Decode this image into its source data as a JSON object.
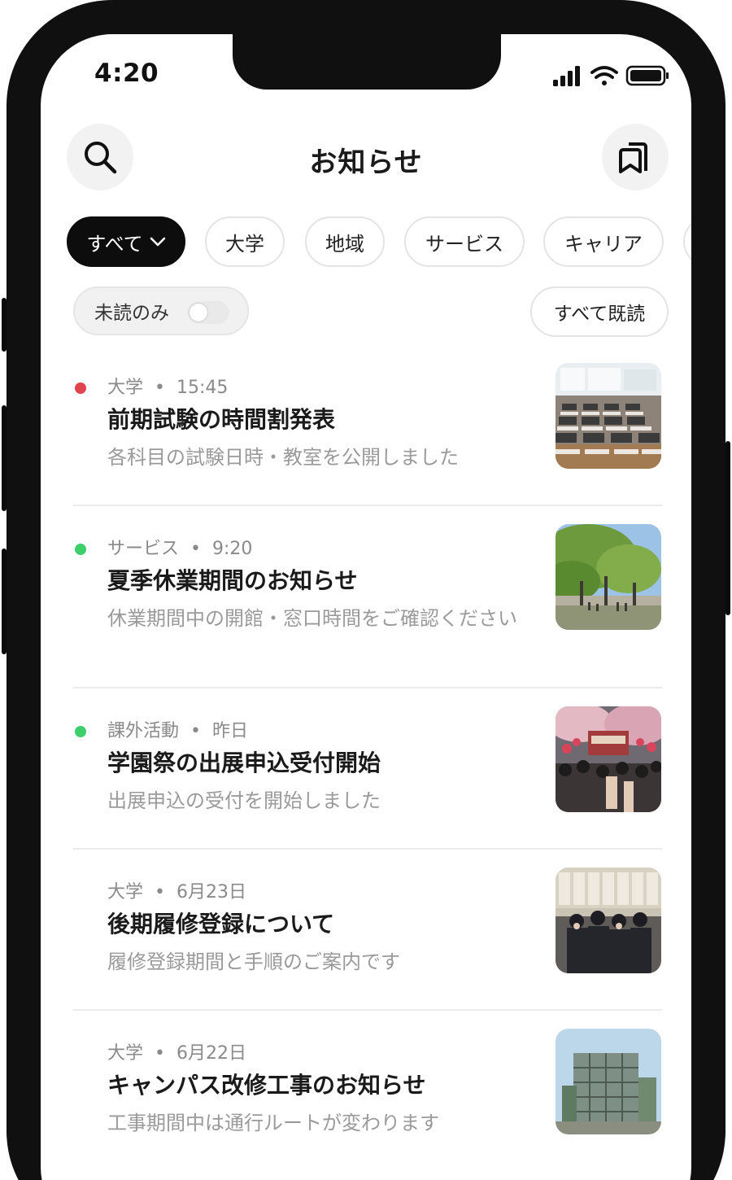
{
  "status_bar": {
    "time": "4:20"
  },
  "header": {
    "title": "お知らせ",
    "search_icon": "search-icon",
    "bookmark_icon": "bookmarks-icon"
  },
  "categories": {
    "items": [
      "すべて",
      "大学",
      "地域",
      "サービス",
      "キャリア"
    ],
    "selected": "すべて"
  },
  "filters": {
    "unread_only_label": "未読のみ",
    "unread_only_enabled": false,
    "mark_all_read_label": "すべて既読"
  },
  "news": [
    {
      "category": "大学",
      "time": "15:45",
      "title": "前期試験の時間割発表",
      "description": "各科目の試験日時・教室を公開しました",
      "dot_color": "#e0444e",
      "thumbnail": "exam-hall-photo"
    },
    {
      "category": "サービス",
      "time": "9:20",
      "title": "夏季休業期間のお知らせ",
      "description": "休業期間中の開館・窓口時間をご確認ください",
      "dot_color": "#3ecf6b",
      "thumbnail": "campus-trees-photo"
    },
    {
      "category": "課外活動",
      "time": "昨日",
      "title": "学園祭の出展申込受付開始",
      "description": "出展申込の受付を開始しました",
      "dot_color": "#3ecf6b",
      "thumbnail": "festival-crowd-photo"
    },
    {
      "category": "大学",
      "time": "6月23日",
      "title": "後期履修登録について",
      "description": "履修登録期間と手順のご案内です",
      "dot_color": null,
      "thumbnail": "students-board-photo"
    },
    {
      "category": "大学",
      "time": "6月22日",
      "title": "キャンパス改修工事のお知らせ",
      "description": "工事期間中は通行ルートが変わります",
      "dot_color": null,
      "thumbnail": "building-construction-photo"
    }
  ]
}
